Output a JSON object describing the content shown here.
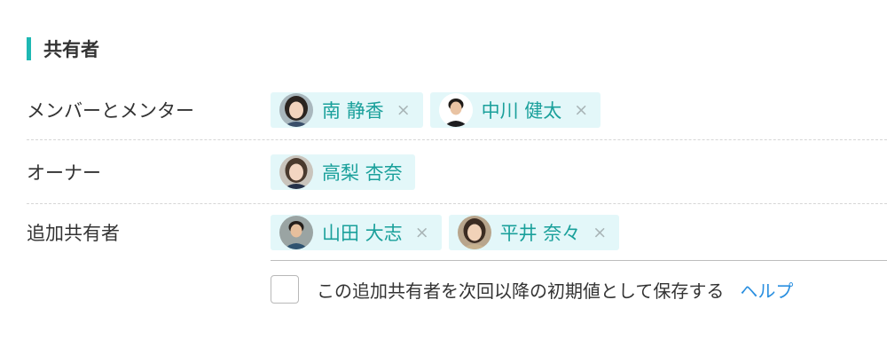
{
  "section": {
    "title": "共有者",
    "accent_color": "#1eb8b3"
  },
  "rows": {
    "members": {
      "label": "メンバーとメンター",
      "people": [
        {
          "name": "南 静香",
          "avatar": "avatar-woman-icon",
          "removable": true
        },
        {
          "name": "中川 健太",
          "avatar": "avatar-man-icon",
          "removable": true
        }
      ]
    },
    "owner": {
      "label": "オーナー",
      "people": [
        {
          "name": "高梨 杏奈",
          "avatar": "avatar-woman-icon",
          "removable": false
        }
      ]
    },
    "additional": {
      "label": "追加共有者",
      "people": [
        {
          "name": "山田 大志",
          "avatar": "avatar-man-icon",
          "removable": true
        },
        {
          "name": "平井 奈々",
          "avatar": "avatar-woman-icon",
          "removable": true
        }
      ]
    }
  },
  "remove_glyph": "×",
  "default_option": {
    "checked": false,
    "label": "この追加共有者を次回以降の初期値として保存する",
    "help_link": "ヘルプ"
  },
  "colors": {
    "chip_background": "#e3f7f9",
    "chip_text": "#1aa09b",
    "link": "#2a8fe0"
  }
}
